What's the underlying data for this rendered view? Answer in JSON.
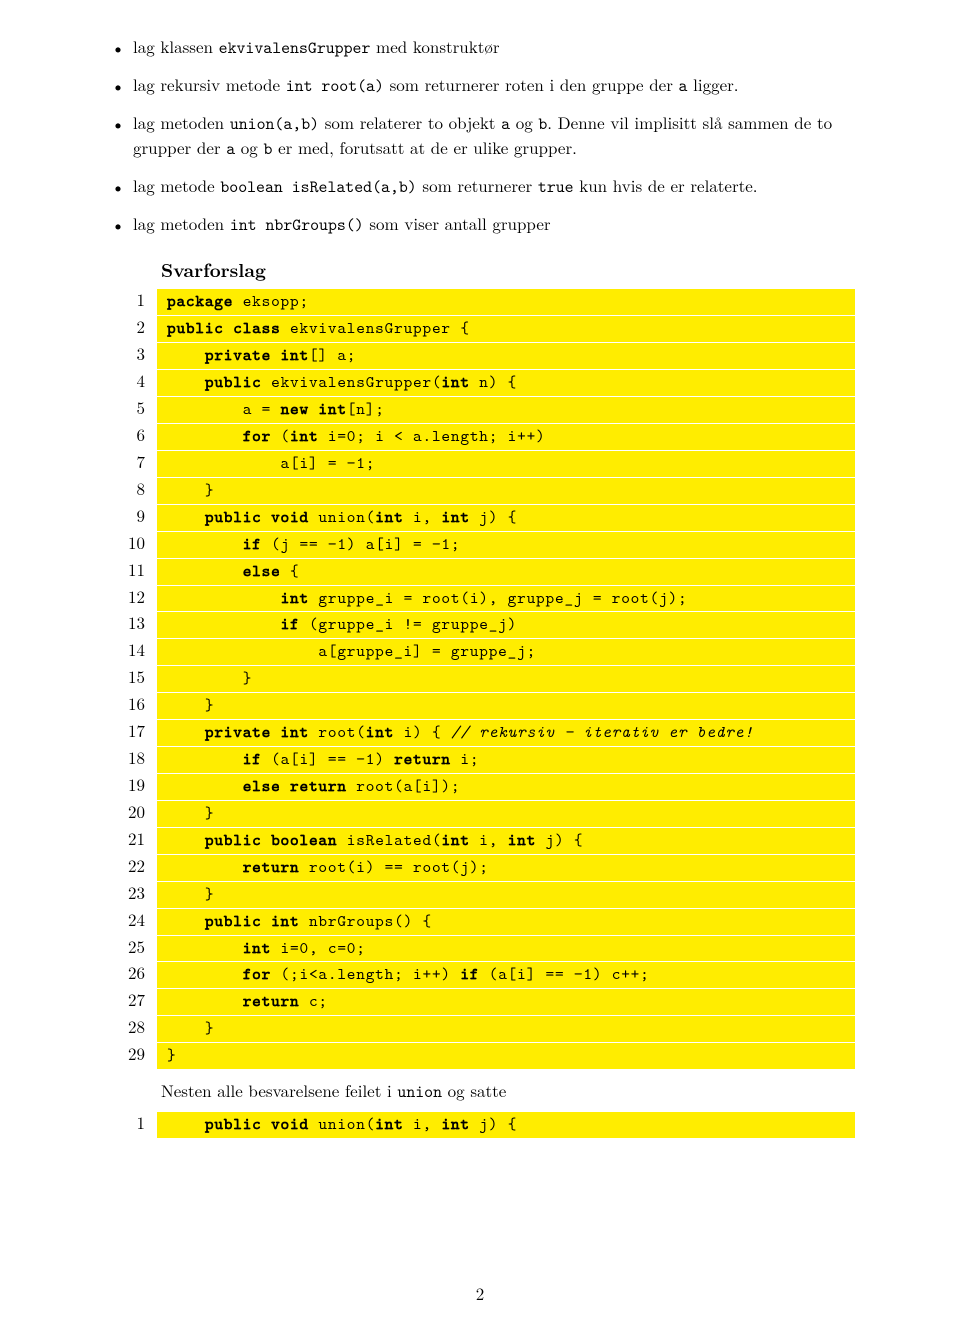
{
  "bullets": [
    [
      {
        "t": "lag klassen "
      },
      {
        "t": "ekvivalensGrupper",
        "tt": true
      },
      {
        "t": " med konstruktør"
      }
    ],
    [
      {
        "t": "lag rekursiv metode "
      },
      {
        "t": "int root(a)",
        "tt": true
      },
      {
        "t": " som returnerer roten i den gruppe der "
      },
      {
        "t": "a",
        "tt": true
      },
      {
        "t": " ligger."
      }
    ],
    [
      {
        "t": "lag metoden "
      },
      {
        "t": "union(a,b)",
        "tt": true
      },
      {
        "t": " som relaterer to objekt "
      },
      {
        "t": "a",
        "tt": true
      },
      {
        "t": " og "
      },
      {
        "t": "b",
        "tt": true
      },
      {
        "t": ". Denne vil implisitt slå sammen de to grupper der "
      },
      {
        "t": "a",
        "tt": true
      },
      {
        "t": " og "
      },
      {
        "t": "b",
        "tt": true
      },
      {
        "t": " er med, forutsatt at de er ulike grupper."
      }
    ],
    [
      {
        "t": "lag metode "
      },
      {
        "t": "boolean isRelated(a,b)",
        "tt": true
      },
      {
        "t": " som returnerer "
      },
      {
        "t": "true",
        "tt": true
      },
      {
        "t": " kun hvis de er relaterte."
      }
    ],
    [
      {
        "t": "lag metoden "
      },
      {
        "t": "int nbrGroups()",
        "tt": true
      },
      {
        "t": " som viser antall grupper"
      }
    ]
  ],
  "heading": "Svarforslag",
  "code1": [
    {
      "n": "1",
      "tokens": [
        {
          "t": "package",
          "kw": true
        },
        {
          "t": " eksopp;"
        }
      ]
    },
    {
      "n": "2",
      "tokens": [
        {
          "t": "public class",
          "kw": true
        },
        {
          "t": " ekvivalensGrupper {"
        }
      ]
    },
    {
      "n": "3",
      "tokens": [
        {
          "t": "    "
        },
        {
          "t": "private int",
          "kw": true
        },
        {
          "t": "[] a;"
        }
      ]
    },
    {
      "n": "4",
      "tokens": [
        {
          "t": "    "
        },
        {
          "t": "public",
          "kw": true
        },
        {
          "t": " ekvivalensGrupper("
        },
        {
          "t": "int",
          "kw": true
        },
        {
          "t": " n) {"
        }
      ]
    },
    {
      "n": "5",
      "tokens": [
        {
          "t": "        a = "
        },
        {
          "t": "new int",
          "kw": true
        },
        {
          "t": "[n];"
        }
      ]
    },
    {
      "n": "6",
      "tokens": [
        {
          "t": "        "
        },
        {
          "t": "for",
          "kw": true
        },
        {
          "t": " ("
        },
        {
          "t": "int",
          "kw": true
        },
        {
          "t": " i=0; i < a.length; i++)"
        }
      ]
    },
    {
      "n": "7",
      "tokens": [
        {
          "t": "            a[i] = −1;"
        }
      ]
    },
    {
      "n": "8",
      "tokens": [
        {
          "t": "    }"
        }
      ]
    },
    {
      "n": "9",
      "tokens": [
        {
          "t": "    "
        },
        {
          "t": "public void",
          "kw": true
        },
        {
          "t": " union("
        },
        {
          "t": "int",
          "kw": true
        },
        {
          "t": " i, "
        },
        {
          "t": "int",
          "kw": true
        },
        {
          "t": " j) {"
        }
      ]
    },
    {
      "n": "10",
      "tokens": [
        {
          "t": "        "
        },
        {
          "t": "if",
          "kw": true
        },
        {
          "t": " (j == −1) a[i] = −1;"
        }
      ]
    },
    {
      "n": "11",
      "tokens": [
        {
          "t": "        "
        },
        {
          "t": "else",
          "kw": true
        },
        {
          "t": " {"
        }
      ]
    },
    {
      "n": "12",
      "tokens": [
        {
          "t": "            "
        },
        {
          "t": "int",
          "kw": true
        },
        {
          "t": " gruppe_i = root(i), gruppe_j = root(j);"
        }
      ]
    },
    {
      "n": "13",
      "tokens": [
        {
          "t": "            "
        },
        {
          "t": "if",
          "kw": true
        },
        {
          "t": " (gruppe_i != gruppe_j)"
        }
      ]
    },
    {
      "n": "14",
      "tokens": [
        {
          "t": "                a[gruppe_i] = gruppe_j;"
        }
      ]
    },
    {
      "n": "15",
      "tokens": [
        {
          "t": "        }"
        }
      ]
    },
    {
      "n": "16",
      "tokens": [
        {
          "t": "    }"
        }
      ]
    },
    {
      "n": "17",
      "tokens": [
        {
          "t": "    "
        },
        {
          "t": "private int",
          "kw": true
        },
        {
          "t": " root("
        },
        {
          "t": "int",
          "kw": true
        },
        {
          "t": " i) { "
        },
        {
          "t": "// rekursiv − iterativ er bedre!",
          "comment": true
        }
      ]
    },
    {
      "n": "18",
      "tokens": [
        {
          "t": "        "
        },
        {
          "t": "if",
          "kw": true
        },
        {
          "t": " (a[i] == −1) "
        },
        {
          "t": "return",
          "kw": true
        },
        {
          "t": " i;"
        }
      ]
    },
    {
      "n": "19",
      "tokens": [
        {
          "t": "        "
        },
        {
          "t": "else return",
          "kw": true
        },
        {
          "t": " root(a[i]);"
        }
      ]
    },
    {
      "n": "20",
      "tokens": [
        {
          "t": "    }"
        }
      ]
    },
    {
      "n": "21",
      "tokens": [
        {
          "t": "    "
        },
        {
          "t": "public boolean",
          "kw": true
        },
        {
          "t": " isRelated("
        },
        {
          "t": "int",
          "kw": true
        },
        {
          "t": " i, "
        },
        {
          "t": "int",
          "kw": true
        },
        {
          "t": " j) {"
        }
      ]
    },
    {
      "n": "22",
      "tokens": [
        {
          "t": "        "
        },
        {
          "t": "return",
          "kw": true
        },
        {
          "t": " root(i) == root(j);"
        }
      ]
    },
    {
      "n": "23",
      "tokens": [
        {
          "t": "    }"
        }
      ]
    },
    {
      "n": "24",
      "tokens": [
        {
          "t": "    "
        },
        {
          "t": "public int",
          "kw": true
        },
        {
          "t": " nbrGroups() {"
        }
      ]
    },
    {
      "n": "25",
      "tokens": [
        {
          "t": "        "
        },
        {
          "t": "int",
          "kw": true
        },
        {
          "t": " i=0, c=0;"
        }
      ]
    },
    {
      "n": "26",
      "tokens": [
        {
          "t": "        "
        },
        {
          "t": "for",
          "kw": true
        },
        {
          "t": " (;i<a.length; i++) "
        },
        {
          "t": "if",
          "kw": true
        },
        {
          "t": " (a[i] == −1) c++;"
        }
      ]
    },
    {
      "n": "27",
      "tokens": [
        {
          "t": "        "
        },
        {
          "t": "return",
          "kw": true
        },
        {
          "t": " c;"
        }
      ]
    },
    {
      "n": "28",
      "tokens": [
        {
          "t": "    }"
        }
      ]
    },
    {
      "n": "29",
      "tokens": [
        {
          "t": "}"
        }
      ]
    }
  ],
  "after_note_parts": [
    {
      "t": "Nesten alle besvarelsene feilet i "
    },
    {
      "t": "union",
      "tt": true
    },
    {
      "t": " og satte"
    }
  ],
  "code2": [
    {
      "n": "1",
      "tokens": [
        {
          "t": "    "
        },
        {
          "t": "public void",
          "kw": true
        },
        {
          "t": " union("
        },
        {
          "t": "int",
          "kw": true
        },
        {
          "t": " i, "
        },
        {
          "t": "int",
          "kw": true
        },
        {
          "t": " j) {"
        }
      ]
    }
  ],
  "page_number": "2"
}
